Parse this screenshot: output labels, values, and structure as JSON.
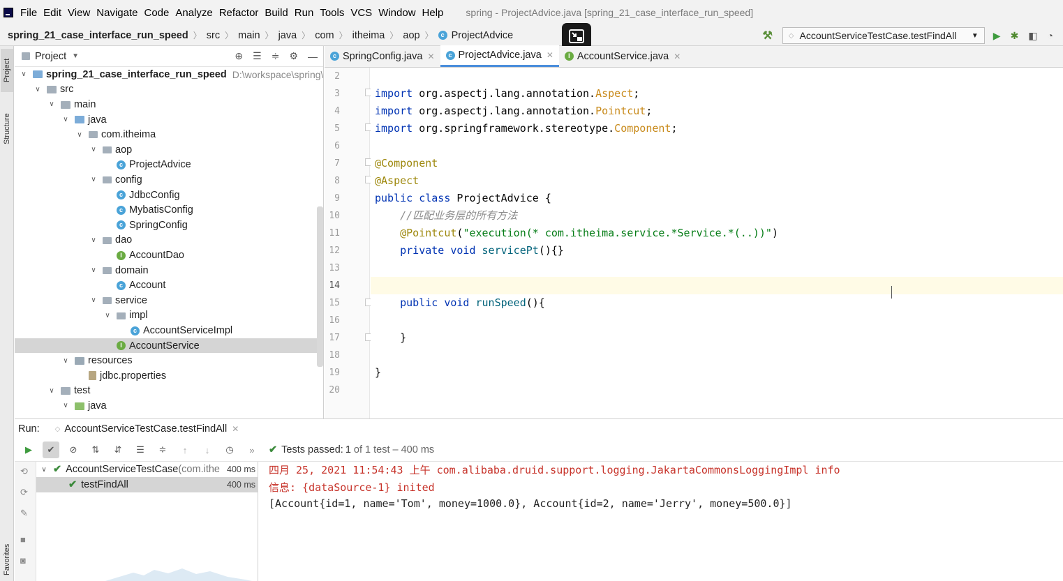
{
  "menubar": {
    "items": [
      "File",
      "Edit",
      "View",
      "Navigate",
      "Code",
      "Analyze",
      "Refactor",
      "Build",
      "Run",
      "Tools",
      "VCS",
      "Window",
      "Help"
    ],
    "window_title": "spring - ProjectAdvice.java [spring_21_case_interface_run_speed]"
  },
  "breadcrumb": {
    "items": [
      "spring_21_case_interface_run_speed",
      "src",
      "main",
      "java",
      "com",
      "itheima",
      "aop",
      "ProjectAdvice"
    ]
  },
  "toolbar": {
    "run_config": "AccountServiceTestCase.testFindAll"
  },
  "project_panel": {
    "title": "Project",
    "root_path": "D:\\workspace\\spring\\",
    "tree": [
      {
        "label": "spring_21_case_interface_run_speed",
        "icon": "module",
        "expanded": true,
        "bold": true
      },
      {
        "label": "src",
        "icon": "folder",
        "expanded": true
      },
      {
        "label": "main",
        "icon": "folder",
        "expanded": true
      },
      {
        "label": "java",
        "icon": "folder-source",
        "expanded": true
      },
      {
        "label": "com.itheima",
        "icon": "package",
        "expanded": true
      },
      {
        "label": "aop",
        "icon": "package",
        "expanded": true
      },
      {
        "label": "ProjectAdvice",
        "icon": "class"
      },
      {
        "label": "config",
        "icon": "package",
        "expanded": true
      },
      {
        "label": "JdbcConfig",
        "icon": "class"
      },
      {
        "label": "MybatisConfig",
        "icon": "class"
      },
      {
        "label": "SpringConfig",
        "icon": "class"
      },
      {
        "label": "dao",
        "icon": "package",
        "expanded": true
      },
      {
        "label": "AccountDao",
        "icon": "interface"
      },
      {
        "label": "domain",
        "icon": "package",
        "expanded": true
      },
      {
        "label": "Account",
        "icon": "class"
      },
      {
        "label": "service",
        "icon": "package",
        "expanded": true
      },
      {
        "label": "impl",
        "icon": "package",
        "expanded": true
      },
      {
        "label": "AccountServiceImpl",
        "icon": "class"
      },
      {
        "label": "AccountService",
        "icon": "interface",
        "selected": true
      },
      {
        "label": "resources",
        "icon": "folder-resources",
        "expanded": true
      },
      {
        "label": "jdbc.properties",
        "icon": "properties"
      },
      {
        "label": "test",
        "icon": "folder",
        "expanded": true
      },
      {
        "label": "java",
        "icon": "folder-test",
        "expanded": true
      }
    ]
  },
  "editor": {
    "tabs": [
      {
        "label": "SpringConfig.java",
        "icon": "class",
        "active": false
      },
      {
        "label": "ProjectAdvice.java",
        "icon": "class",
        "active": true
      },
      {
        "label": "AccountService.java",
        "icon": "interface",
        "active": false
      }
    ],
    "line_numbers": [
      "2",
      "3",
      "4",
      "5",
      "6",
      "7",
      "8",
      "9",
      "10",
      "11",
      "12",
      "13",
      "14",
      "15",
      "16",
      "17",
      "18",
      "19",
      "20"
    ],
    "current_line": "14",
    "tokens": {
      "l3": [
        "import",
        " org.aspectj.lang.annotation.",
        "Aspect",
        ";"
      ],
      "l4": [
        "import",
        " org.aspectj.lang.annotation.",
        "Pointcut",
        ";"
      ],
      "l5": [
        "import",
        " org.springframework.stereotype.",
        "Component",
        ";"
      ],
      "l7": [
        "@Component"
      ],
      "l8": [
        "@Aspect"
      ],
      "l9": [
        "public class",
        " ProjectAdvice {"
      ],
      "l10": [
        "    ",
        "//匹配业务层的所有方法"
      ],
      "l11": [
        "    ",
        "@Pointcut",
        "(",
        "\"execution(* com.itheima.service.*Service.*(..))\"",
        ")"
      ],
      "l12": [
        "    ",
        "private void",
        " ",
        "servicePt",
        "(){}"
      ],
      "l15": [
        "    ",
        "public void",
        " ",
        "runSpeed",
        "(){"
      ],
      "l17": [
        "    }"
      ],
      "l19": [
        "}"
      ]
    }
  },
  "run_panel": {
    "label": "Run:",
    "tab": "AccountServiceTestCase.testFindAll",
    "status_prefix": "Tests passed: ",
    "passed": "1",
    "status_suffix": " of 1 test – 400 ms",
    "tests": [
      {
        "name": "AccountServiceTestCase",
        "detail": " (com.ithe",
        "duration": "400 ms"
      },
      {
        "name": "testFindAll",
        "detail": "",
        "duration": "400 ms"
      }
    ],
    "console": [
      "四月 25, 2021 11:54:43 上午 com.alibaba.druid.support.logging.JakartaCommonsLoggingImpl info",
      "信息: {dataSource-1} inited",
      "[Account{id=1, name='Tom', money=1000.0}, Account{id=2, name='Jerry', money=500.0}]"
    ]
  },
  "side_tabs": {
    "project": "Project",
    "structure": "Structure",
    "favorites": "Favorites"
  }
}
